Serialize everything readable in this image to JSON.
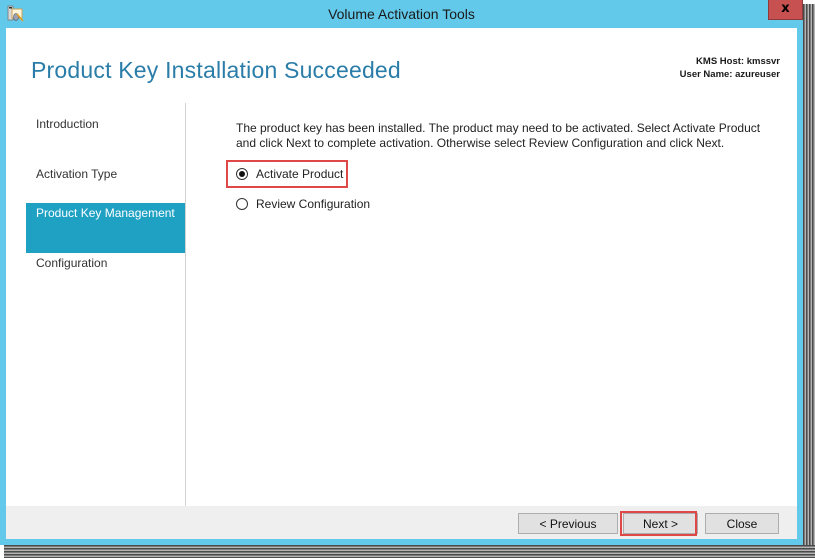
{
  "window": {
    "title": "Volume Activation Tools",
    "close_label": "x",
    "app_icon": "volume-activation-icon"
  },
  "header": {
    "page_title": "Product Key Installation Succeeded",
    "kms_host": "KMS Host: kmssvr",
    "user_name": "User Name: azureuser"
  },
  "nav": {
    "items": [
      {
        "label": "Introduction",
        "selected": false
      },
      {
        "label": "Activation Type",
        "selected": false
      },
      {
        "label": "Product Key Management",
        "selected": true
      },
      {
        "label": "Configuration",
        "selected": false
      }
    ]
  },
  "content": {
    "description": "The product key has been installed. The product may need to be activated. Select Activate Product and click Next to complete activation. Otherwise select Review Configuration and click Next.",
    "options": [
      {
        "label": "Activate Product",
        "checked": true
      },
      {
        "label": "Review Configuration",
        "checked": false
      }
    ]
  },
  "footer": {
    "previous_label": "< Previous",
    "next_label": "Next >",
    "close_label": "Close"
  },
  "colors": {
    "frame": "#62c9ea",
    "accent": "#1fa1c4",
    "title_text": "#2a7da8",
    "close_button": "#c75050",
    "highlight": "#e04848"
  }
}
